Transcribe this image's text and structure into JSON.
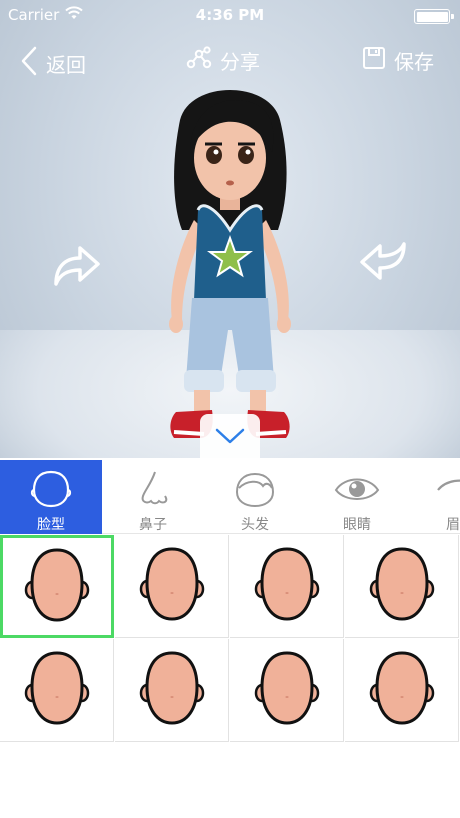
{
  "status_bar": {
    "carrier": "Carrier",
    "time": "4:36 PM",
    "battery_level": 1.0
  },
  "nav": {
    "back_label": "返回",
    "share_label": "分享",
    "save_label": "保存"
  },
  "tabs": [
    {
      "label": "脸型",
      "icon": "face-shape-icon",
      "active": true
    },
    {
      "label": "鼻子",
      "icon": "nose-icon",
      "active": false
    },
    {
      "label": "头发",
      "icon": "hair-icon",
      "active": false
    },
    {
      "label": "眼睛",
      "icon": "eye-icon",
      "active": false
    },
    {
      "label": "眉",
      "icon": "eyebrow-icon",
      "active": false
    }
  ],
  "face_options": {
    "count": 8,
    "selected_index": 0
  },
  "colors": {
    "accent": "#2d5ee0",
    "selected_border": "#4cd964",
    "skin": "#f0b199",
    "shirt": "#1f5f8c",
    "shoes": "#c8202a"
  }
}
